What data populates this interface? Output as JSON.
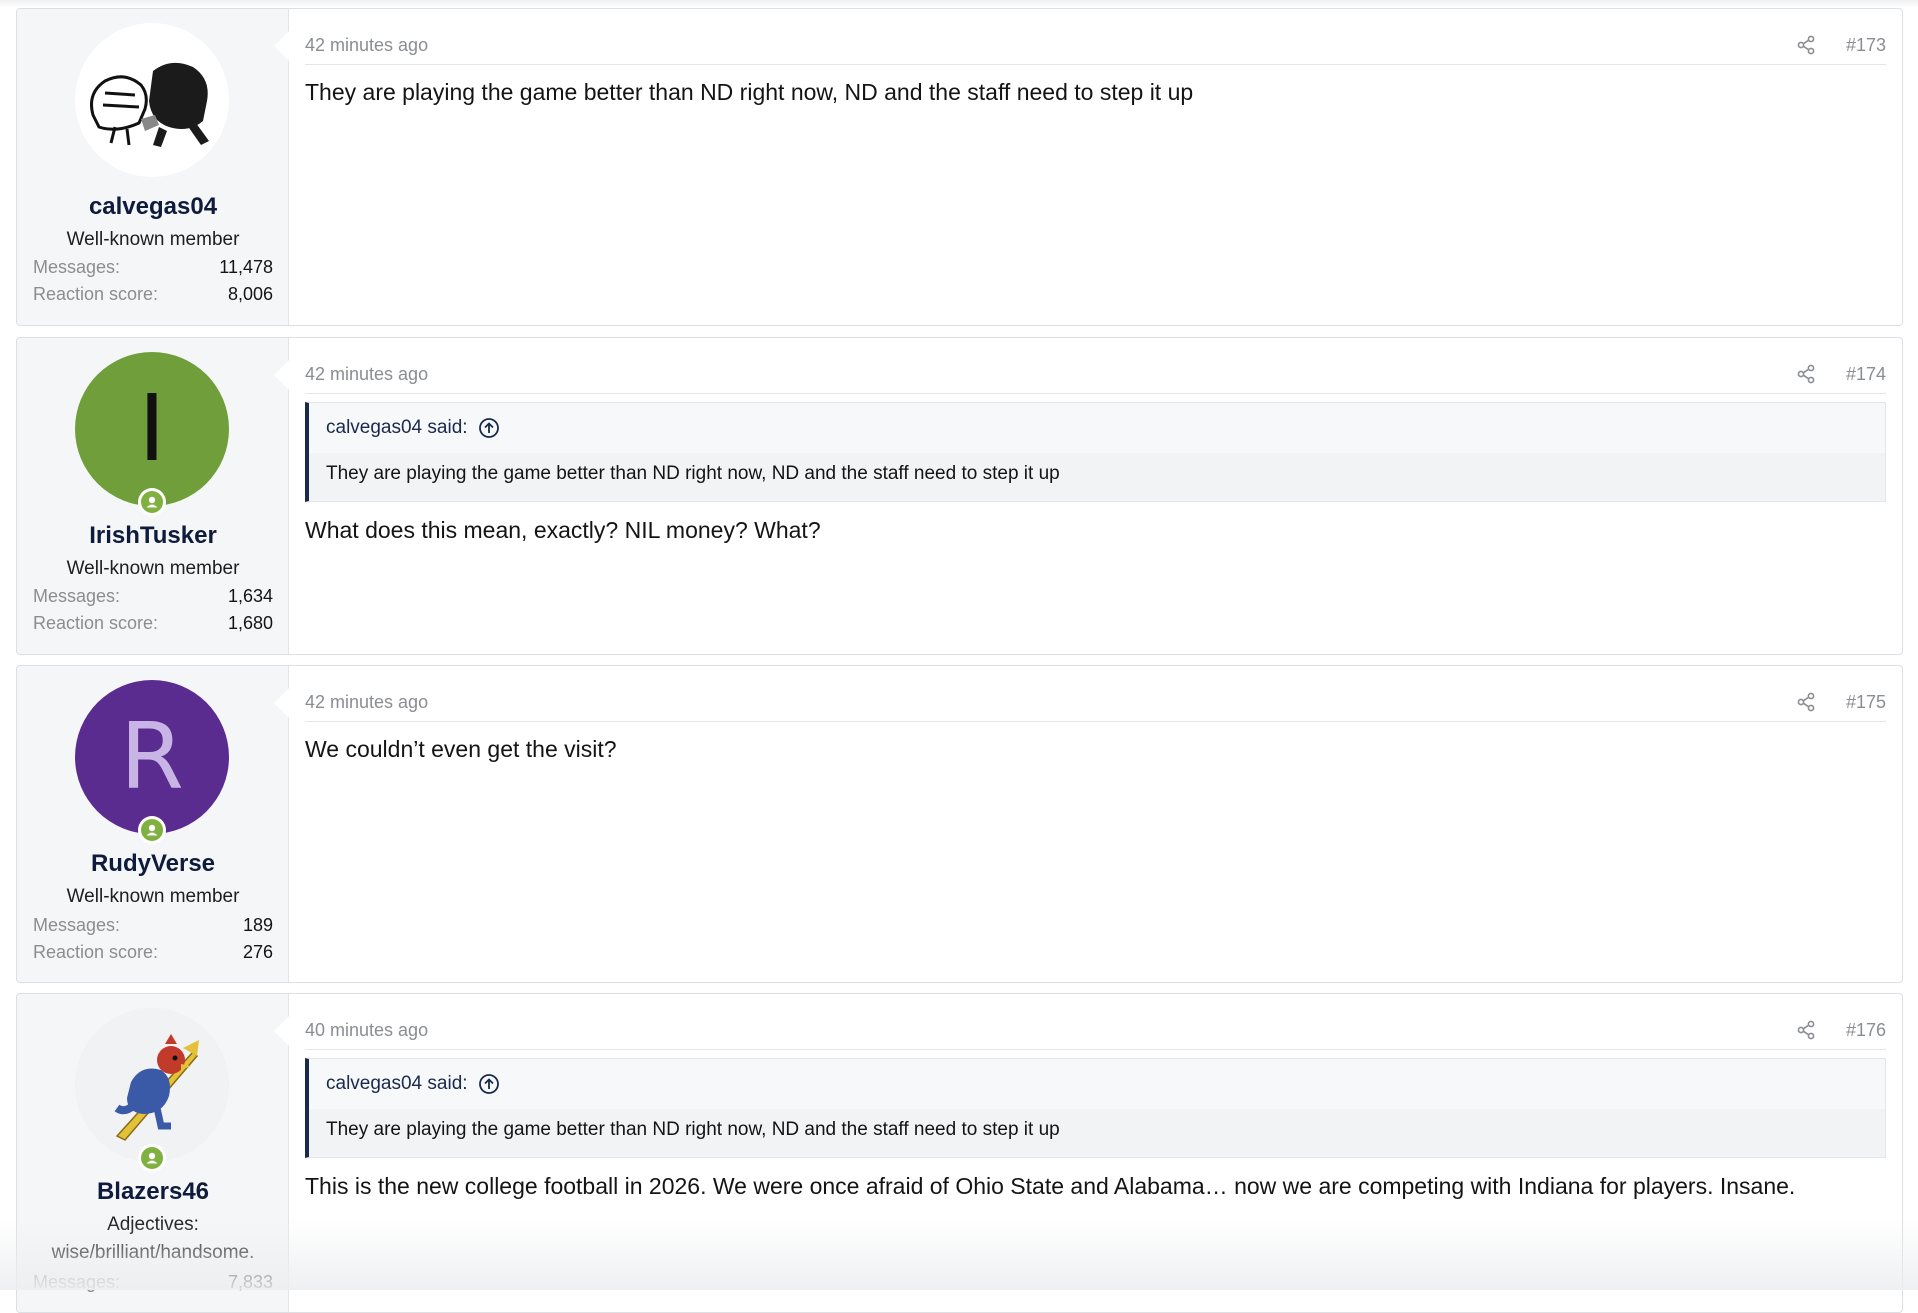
{
  "posts": [
    {
      "time": "42 minutes ago",
      "number": "#173",
      "user": {
        "name": "calvegas04",
        "title": "Well-known member",
        "messages_label": "Messages:",
        "messages": "11,478",
        "reaction_label": "Reaction score:",
        "reaction": "8,006",
        "avatar": "helmet-mascot-image",
        "online": false
      },
      "body": "They are playing the game better than ND right now, ND and the staff need to step it up"
    },
    {
      "time": "42 minutes ago",
      "number": "#174",
      "user": {
        "name": "IrishTusker",
        "title": "Well-known member",
        "messages_label": "Messages:",
        "messages": "1,634",
        "reaction_label": "Reaction score:",
        "reaction": "1,680",
        "avatar_letter": "I",
        "avatar_color": "#6f9e3a",
        "online": true
      },
      "quote": {
        "author": "calvegas04 said:",
        "text": "They are playing the game better than ND right now, ND and the staff need to step it up"
      },
      "body": "What does this mean, exactly? NIL money? What?"
    },
    {
      "time": "42 minutes ago",
      "number": "#175",
      "user": {
        "name": "RudyVerse",
        "title": "Well-known member",
        "messages_label": "Messages:",
        "messages": "189",
        "reaction_label": "Reaction score:",
        "reaction": "276",
        "avatar_letter": "R",
        "avatar_color": "#5b2c8f",
        "online": true
      },
      "body": "We couldn’t even get the visit?"
    },
    {
      "time": "40 minutes ago",
      "number": "#176",
      "user": {
        "name": "Blazers46",
        "title": "Adjectives: wise/brilliant/handsome.",
        "messages_label": "Messages:",
        "messages": "7,833",
        "avatar": "rider-mascot-image",
        "online": true
      },
      "quote": {
        "author": "calvegas04 said:",
        "text": "They are playing the game better than ND right now, ND and the staff need to step it up"
      },
      "body": "This is the new college football in 2026. We were once afraid of Ohio State and Alabama… now we are competing with Indiana for players. Insane."
    }
  ],
  "colors": {
    "online": "#7fb040",
    "username": "#0e1b3c",
    "quote_border": "#1a2a4c"
  }
}
